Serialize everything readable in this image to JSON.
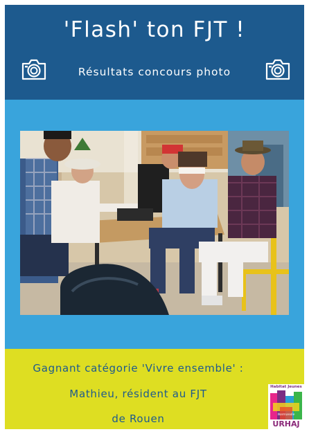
{
  "header": {
    "title": "'Flash' ton FJT !",
    "subtitle": "Résultats concours photo",
    "icons": [
      "camera-icon",
      "camera-icon"
    ]
  },
  "photo": {
    "subject": "photo-of-residents-at-table"
  },
  "footer": {
    "line1": "Gagnant catégorie 'Vivre ensemble' :",
    "line2": "Mathieu, résident au FJT",
    "line3": "de Rouen"
  },
  "logo": {
    "top_text": "Habitat Jeunes",
    "sub_text": "Normandie",
    "name": "URHAJ"
  },
  "colors": {
    "header": "#1d5a8e",
    "background": "#39a4dc",
    "footer": "#dede22",
    "caption_text": "#1d5a8e"
  }
}
